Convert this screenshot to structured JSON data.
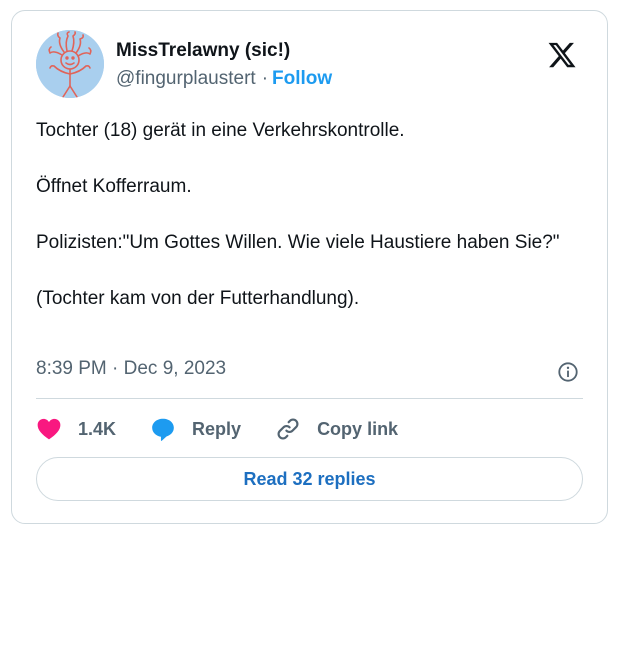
{
  "author": {
    "display_name": "MissTrelawny (sic!)",
    "handle": "@fingurplaustert",
    "separator": "·",
    "follow_label": "Follow"
  },
  "tweet": {
    "paragraphs": [
      "Tochter (18) gerät in eine Verkehrskontrolle.",
      "Öffnet Kofferraum.",
      "Polizisten:\"Um Gottes Willen. Wie viele Haustiere haben Sie?\"",
      "(Tochter kam von der Futterhandlung)."
    ],
    "timestamp": "8:39 PM · Dec 9, 2023"
  },
  "actions": {
    "like_count": "1.4K",
    "reply_label": "Reply",
    "copy_link_label": "Copy link"
  },
  "read_replies_label": "Read 32 replies",
  "icons": {
    "brand": "x-logo-icon",
    "info": "info-icon",
    "like": "heart-icon",
    "reply": "speech-bubble-icon",
    "copy": "link-icon"
  },
  "colors": {
    "accent": "#1d9bf0",
    "like": "#f91880",
    "secondary_text": "#536471",
    "border": "#cfd9de"
  }
}
